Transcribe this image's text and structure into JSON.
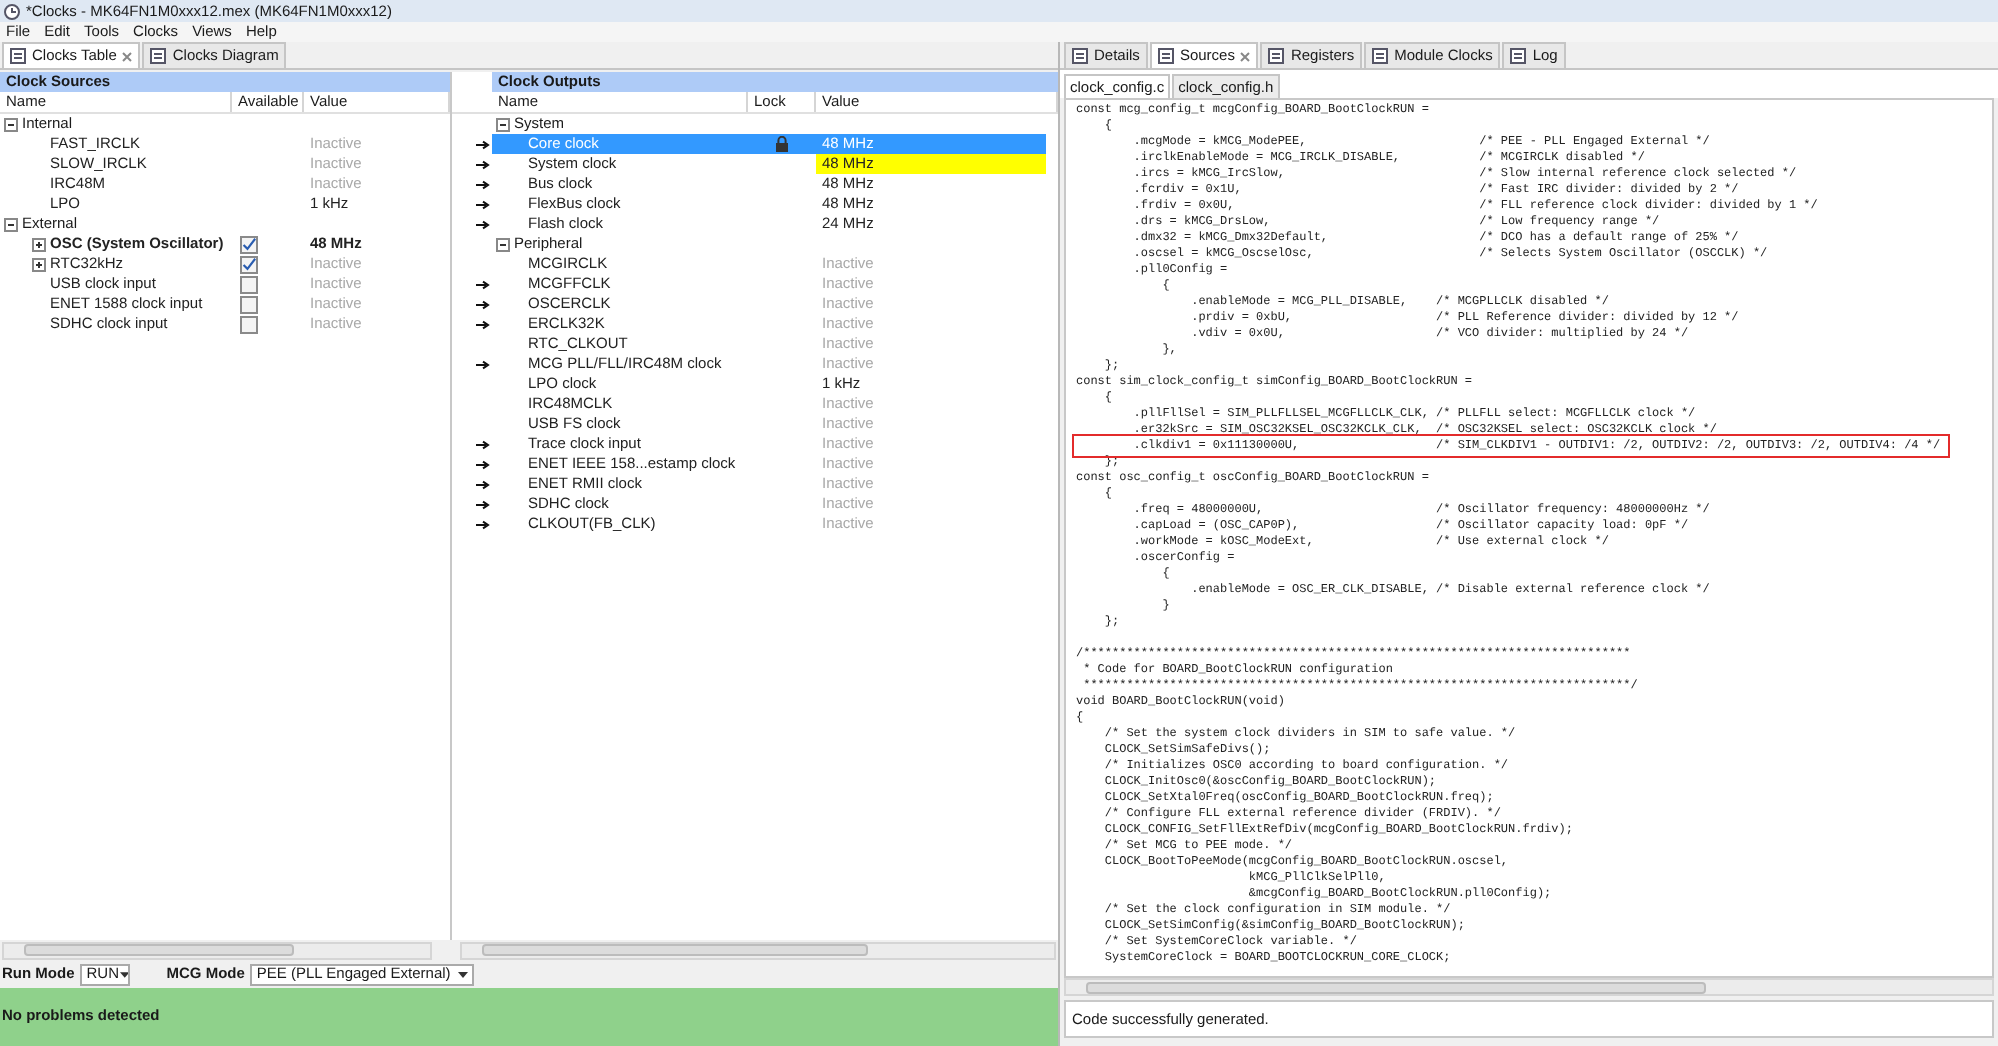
{
  "window": {
    "title": "*Clocks - MK64FN1M0xxx12.mex (MK64FN1M0xxx12)"
  },
  "menu": [
    "File",
    "Edit",
    "Tools",
    "Clocks",
    "Views",
    "Help"
  ],
  "left_tabs": [
    {
      "label": "Clocks Table",
      "selected": true
    },
    {
      "label": "Clocks Diagram",
      "selected": false
    }
  ],
  "clock_sources": {
    "title": "Clock Sources",
    "columns": [
      "Name",
      "Available",
      "Value"
    ],
    "groups": [
      {
        "label": "Internal",
        "expanded": true,
        "items": [
          {
            "name": "FAST_IRCLK",
            "value": "Inactive",
            "active": false,
            "bold": false
          },
          {
            "name": "SLOW_IRCLK",
            "value": "Inactive",
            "active": false,
            "bold": false
          },
          {
            "name": "IRC48M",
            "value": "Inactive",
            "active": false,
            "bold": false
          },
          {
            "name": "LPO",
            "value": "1 kHz",
            "active": true,
            "bold": false
          }
        ]
      },
      {
        "label": "External",
        "expanded": true,
        "items": [
          {
            "name": "OSC (System Oscillator)",
            "expanded": false,
            "checked": true,
            "value": "48 MHz",
            "active": true,
            "bold": true
          },
          {
            "name": "RTC32kHz",
            "expanded": false,
            "checked": true,
            "value": "Inactive",
            "active": false,
            "bold": false
          },
          {
            "name": "USB clock input",
            "checked": false,
            "value": "Inactive",
            "active": false,
            "bold": false
          },
          {
            "name": "ENET 1588 clock input",
            "checked": false,
            "value": "Inactive",
            "active": false,
            "bold": false
          },
          {
            "name": "SDHC clock input",
            "checked": false,
            "value": "Inactive",
            "active": false,
            "bold": false
          }
        ]
      }
    ]
  },
  "clock_outputs": {
    "title": "Clock Outputs",
    "columns": [
      "Name",
      "Lock",
      "Value"
    ],
    "groups": [
      {
        "label": "System",
        "expanded": true,
        "items": [
          {
            "name": "Core clock",
            "connected": true,
            "locked": true,
            "value": "48 MHz",
            "active": true,
            "selected": true,
            "value_highlighted": false
          },
          {
            "name": "System clock",
            "connected": true,
            "locked": false,
            "value": "48 MHz",
            "active": true,
            "selected": false,
            "value_highlighted": true
          },
          {
            "name": "Bus clock",
            "connected": true,
            "locked": false,
            "value": "48 MHz",
            "active": true,
            "selected": false,
            "value_highlighted": false
          },
          {
            "name": "FlexBus clock",
            "connected": true,
            "locked": false,
            "value": "48 MHz",
            "active": true,
            "selected": false,
            "value_highlighted": false
          },
          {
            "name": "Flash clock",
            "connected": true,
            "locked": false,
            "value": "24 MHz",
            "active": true,
            "selected": false,
            "value_highlighted": false
          }
        ]
      },
      {
        "label": "Peripheral",
        "expanded": true,
        "items": [
          {
            "name": "MCGIRCLK",
            "connected": false,
            "locked": false,
            "value": "Inactive",
            "active": false,
            "selected": false,
            "value_highlighted": false
          },
          {
            "name": "MCGFFCLK",
            "connected": true,
            "locked": false,
            "value": "Inactive",
            "active": false,
            "selected": false,
            "value_highlighted": false
          },
          {
            "name": "OSCERCLK",
            "connected": true,
            "locked": false,
            "value": "Inactive",
            "active": false,
            "selected": false,
            "value_highlighted": false
          },
          {
            "name": "ERCLK32K",
            "connected": true,
            "locked": false,
            "value": "Inactive",
            "active": false,
            "selected": false,
            "value_highlighted": false
          },
          {
            "name": "RTC_CLKOUT",
            "connected": false,
            "locked": false,
            "value": "Inactive",
            "active": false,
            "selected": false,
            "value_highlighted": false
          },
          {
            "name": "MCG PLL/FLL/IRC48M clock",
            "connected": true,
            "locked": false,
            "value": "Inactive",
            "active": false,
            "selected": false,
            "value_highlighted": false
          },
          {
            "name": "LPO clock",
            "connected": false,
            "locked": false,
            "value": "1 kHz",
            "active": true,
            "selected": false,
            "value_highlighted": false
          },
          {
            "name": "IRC48MCLK",
            "connected": false,
            "locked": false,
            "value": "Inactive",
            "active": false,
            "selected": false,
            "value_highlighted": false
          },
          {
            "name": "USB FS clock",
            "connected": false,
            "locked": false,
            "value": "Inactive",
            "active": false,
            "selected": false,
            "value_highlighted": false
          },
          {
            "name": "Trace clock input",
            "connected": true,
            "locked": false,
            "value": "Inactive",
            "active": false,
            "selected": false,
            "value_highlighted": false
          },
          {
            "name": "ENET IEEE 158...estamp clock",
            "connected": true,
            "locked": false,
            "value": "Inactive",
            "active": false,
            "selected": false,
            "value_highlighted": false
          },
          {
            "name": "ENET RMII clock",
            "connected": true,
            "locked": false,
            "value": "Inactive",
            "active": false,
            "selected": false,
            "value_highlighted": false
          },
          {
            "name": "SDHC clock",
            "connected": true,
            "locked": false,
            "value": "Inactive",
            "active": false,
            "selected": false,
            "value_highlighted": false
          },
          {
            "name": "CLKOUT(FB_CLK)",
            "connected": true,
            "locked": false,
            "value": "Inactive",
            "active": false,
            "selected": false,
            "value_highlighted": false
          }
        ]
      }
    ]
  },
  "run_mode": {
    "label": "Run Mode",
    "value": "RUN"
  },
  "mcg_mode": {
    "label": "MCG Mode",
    "value": "PEE (PLL Engaged External)"
  },
  "problems": "No problems detected",
  "right_tabs": [
    {
      "label": "Details",
      "selected": false
    },
    {
      "label": "Sources",
      "selected": true
    },
    {
      "label": "Registers",
      "selected": false
    },
    {
      "label": "Module Clocks",
      "selected": false
    },
    {
      "label": "Log",
      "selected": false
    }
  ],
  "file_tabs": [
    {
      "label": "clock_config.c",
      "selected": true
    },
    {
      "label": "clock_config.h",
      "selected": false
    }
  ],
  "code_lines": [
    {
      "kind": "code",
      "text": "const mcg_config_t mcgConfig_BOARD_BootClockRUN =",
      "marked": false
    },
    {
      "kind": "code",
      "text": "    {",
      "marked": false
    },
    {
      "kind": "code",
      "text": "        .mcgMode = kMCG_ModePEE,                        /* PEE - PLL Engaged External */",
      "marked": false
    },
    {
      "kind": "code",
      "text": "        .irclkEnableMode = MCG_IRCLK_DISABLE,           /* MCGIRCLK disabled */",
      "marked": false
    },
    {
      "kind": "code",
      "text": "        .ircs = kMCG_IrcSlow,                           /* Slow internal reference clock selected */",
      "marked": false
    },
    {
      "kind": "code",
      "text": "        .fcrdiv = 0x1U,                                 /* Fast IRC divider: divided by 2 */",
      "marked": false
    },
    {
      "kind": "code",
      "text": "        .frdiv = 0x0U,                                  /* FLL reference clock divider: divided by 1 */",
      "marked": false
    },
    {
      "kind": "code",
      "text": "        .drs = kMCG_DrsLow,                             /* Low frequency range */",
      "marked": false
    },
    {
      "kind": "code",
      "text": "        .dmx32 = kMCG_Dmx32Default,                     /* DCO has a default range of 25% */",
      "marked": false
    },
    {
      "kind": "code",
      "text": "        .oscsel = kMCG_OscselOsc,                       /* Selects System Oscillator (OSCCLK) */",
      "marked": false
    },
    {
      "kind": "code",
      "text": "        .pll0Config =",
      "marked": false
    },
    {
      "kind": "code",
      "text": "            {",
      "marked": false
    },
    {
      "kind": "code",
      "text": "                .enableMode = MCG_PLL_DISABLE,    /* MCGPLLCLK disabled */",
      "marked": false
    },
    {
      "kind": "code",
      "text": "                .prdiv = 0xbU,                    /* PLL Reference divider: divided by 12 */",
      "marked": false
    },
    {
      "kind": "code",
      "text": "                .vdiv = 0x0U,                     /* VCO divider: multiplied by 24 */",
      "marked": false
    },
    {
      "kind": "code",
      "text": "            },",
      "marked": false
    },
    {
      "kind": "code",
      "text": "    };",
      "marked": false
    },
    {
      "kind": "code",
      "text": "const sim_clock_config_t simConfig_BOARD_BootClockRUN =",
      "marked": false
    },
    {
      "kind": "code",
      "text": "    {",
      "marked": false
    },
    {
      "kind": "code",
      "text": "        .pllFllSel = SIM_PLLFLLSEL_MCGFLLCLK_CLK, /* PLLFLL select: MCGFLLCLK clock */",
      "marked": false
    },
    {
      "kind": "code",
      "text": "        .er32kSrc = SIM_OSC32KSEL_OSC32KCLK_CLK,  /* OSC32KSEL select: OSC32KCLK clock */",
      "marked": false
    },
    {
      "kind": "code",
      "text": "        .clkdiv1 = 0x11130000U,                   /* SIM_CLKDIV1 - OUTDIV1: /2, OUTDIV2: /2, OUTDIV3: /2, OUTDIV4: /4 */",
      "marked": true
    },
    {
      "kind": "code",
      "text": "    };",
      "marked": false
    },
    {
      "kind": "code",
      "text": "const osc_config_t oscConfig_BOARD_BootClockRUN =",
      "marked": false
    },
    {
      "kind": "code",
      "text": "    {",
      "marked": false
    },
    {
      "kind": "code",
      "text": "        .freq = 48000000U,                        /* Oscillator frequency: 48000000Hz */",
      "marked": false
    },
    {
      "kind": "code",
      "text": "        .capLoad = (OSC_CAP0P),                   /* Oscillator capacity load: 0pF */",
      "marked": false
    },
    {
      "kind": "code",
      "text": "        .workMode = kOSC_ModeExt,                 /* Use external clock */",
      "marked": false
    },
    {
      "kind": "code",
      "text": "        .oscerConfig =",
      "marked": false
    },
    {
      "kind": "code",
      "text": "            {",
      "marked": false
    },
    {
      "kind": "code",
      "text": "                .enableMode = OSC_ER_CLK_DISABLE, /* Disable external reference clock */",
      "marked": false
    },
    {
      "kind": "code",
      "text": "            }",
      "marked": false
    },
    {
      "kind": "code",
      "text": "    };",
      "marked": false
    },
    {
      "kind": "blank",
      "marked": false
    },
    {
      "kind": "code",
      "text": "/****************************************************************************",
      "marked": false
    },
    {
      "kind": "code",
      "text": " * Code for BOARD_BootClockRUN configuration",
      "marked": false
    },
    {
      "kind": "code",
      "text": " ****************************************************************************/",
      "marked": false
    },
    {
      "kind": "code",
      "text": "void BOARD_BootClockRUN(void)",
      "marked": false
    },
    {
      "kind": "code",
      "text": "{",
      "marked": false
    },
    {
      "kind": "code",
      "text": "    /* Set the system clock dividers in SIM to safe value. */",
      "marked": false
    },
    {
      "kind": "code",
      "text": "    CLOCK_SetSimSafeDivs();",
      "marked": false
    },
    {
      "kind": "code",
      "text": "    /* Initializes OSC0 according to board configuration. */",
      "marked": false
    },
    {
      "kind": "code",
      "text": "    CLOCK_InitOsc0(&oscConfig_BOARD_BootClockRUN);",
      "marked": false
    },
    {
      "kind": "code",
      "text": "    CLOCK_SetXtal0Freq(oscConfig_BOARD_BootClockRUN.freq);",
      "marked": false
    },
    {
      "kind": "code",
      "text": "    /* Configure FLL external reference divider (FRDIV). */",
      "marked": false
    },
    {
      "kind": "code",
      "text": "    CLOCK_CONFIG_SetFllExtRefDiv(mcgConfig_BOARD_BootClockRUN.frdiv);",
      "marked": false
    },
    {
      "kind": "code",
      "text": "    /* Set MCG to PEE mode. */",
      "marked": false
    },
    {
      "kind": "code",
      "text": "    CLOCK_BootToPeeMode(mcgConfig_BOARD_BootClockRUN.oscsel,",
      "marked": false
    },
    {
      "kind": "code",
      "text": "                        kMCG_PllClkSelPll0,",
      "marked": false
    },
    {
      "kind": "code",
      "text": "                        &mcgConfig_BOARD_BootClockRUN.pll0Config);",
      "marked": false
    },
    {
      "kind": "code",
      "text": "    /* Set the clock configuration in SIM module. */",
      "marked": false
    },
    {
      "kind": "code",
      "text": "    CLOCK_SetSimConfig(&simConfig_BOARD_BootClockRUN);",
      "marked": false
    },
    {
      "kind": "code",
      "text": "    /* Set SystemCoreClock variable. */",
      "marked": false
    },
    {
      "kind": "code",
      "text": "    SystemCoreClock = BOARD_BOOTCLOCKRUN_CORE_CLOCK;",
      "marked": false
    }
  ],
  "code_status": "Code successfully generated."
}
